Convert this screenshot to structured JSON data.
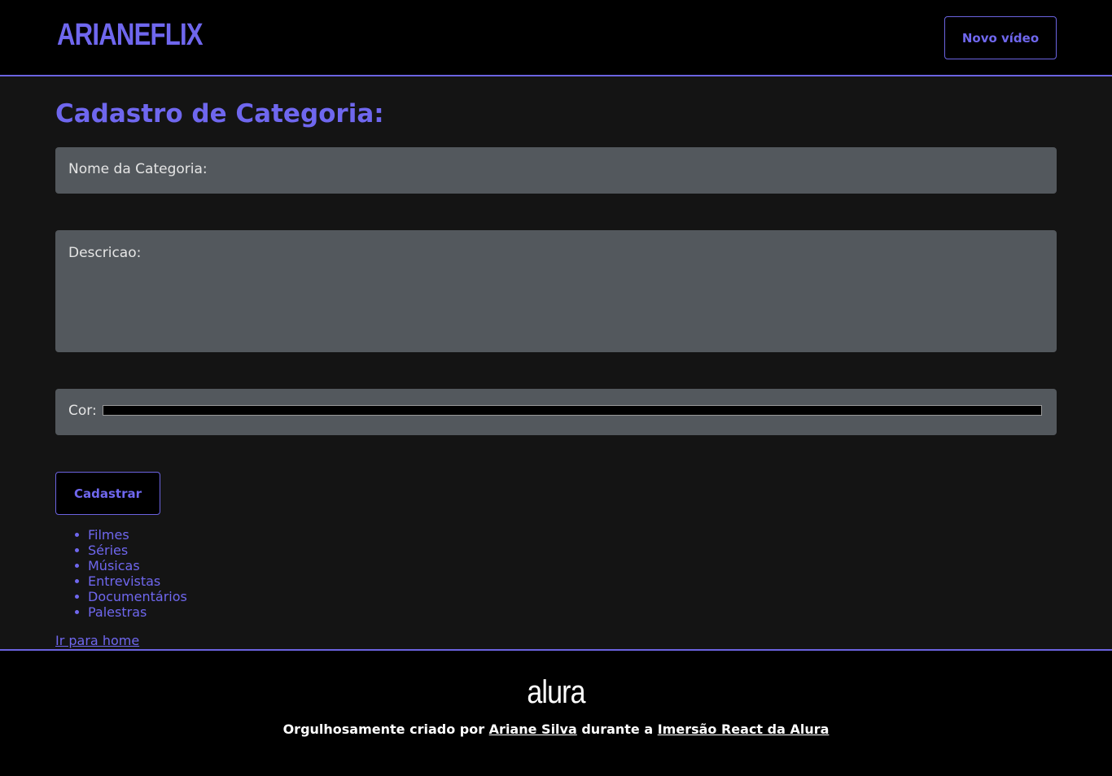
{
  "header": {
    "logo": "ARIANEFLIX",
    "new_video_label": "Novo vídeo"
  },
  "form": {
    "title": "Cadastro de Categoria:",
    "name_label": "Nome da Categoria:",
    "description_label": "Descricao:",
    "color_label": "Cor:",
    "color_value": "#000000",
    "submit_label": "Cadastrar"
  },
  "categories": [
    "Filmes",
    "Séries",
    "Músicas",
    "Entrevistas",
    "Documentários",
    "Palestras"
  ],
  "home_link": "Ir para home",
  "footer": {
    "logo": "alura",
    "text_prefix": "Orgulhosamente criado por",
    "author_link": "Ariane Silva",
    "text_middle": "durante a",
    "event_link": "Imersão React da Alura"
  },
  "colors": {
    "accent": "#6f67ee",
    "background": "#141414",
    "header_background": "#000000",
    "field_background": "#53585d"
  }
}
